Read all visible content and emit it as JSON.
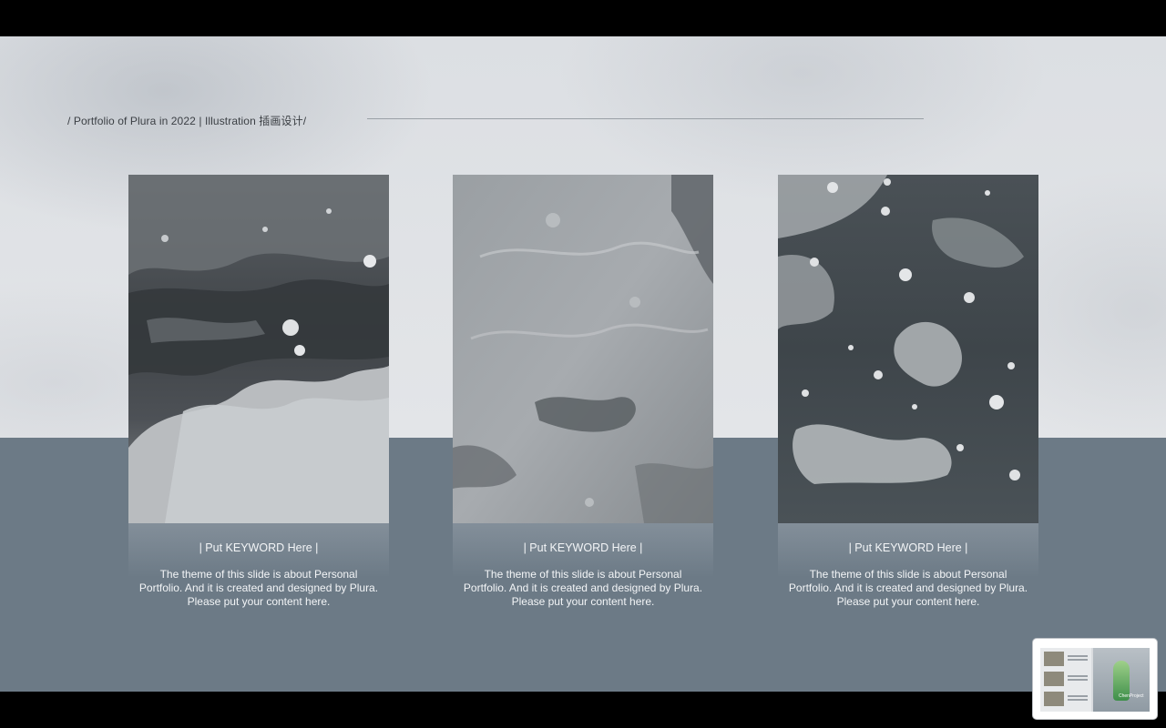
{
  "header": {
    "title": "/ Portfolio of Plura in 2022 | Illustration 插画设计/"
  },
  "cards": [
    {
      "keyword": "| Put KEYWORD Here |",
      "description": "The theme of this slide is about Personal Portfolio. And it is created and designed by Plura. Please put your content here."
    },
    {
      "keyword": "| Put KEYWORD Here |",
      "description": "The theme of this slide is about Personal Portfolio. And it is created and designed by Plura. Please put your content here."
    },
    {
      "keyword": "| Put KEYWORD Here |",
      "description": "The theme of this slide is about Personal Portfolio. And it is created and designed by Plura. Please put your content here."
    }
  ],
  "thumbnail": {
    "caption": "ChenProject"
  },
  "colors": {
    "background": "#e3e5e8",
    "floor": "#6c7a86",
    "text_dark": "#3b3f44",
    "text_light": "#f3f5f7"
  }
}
